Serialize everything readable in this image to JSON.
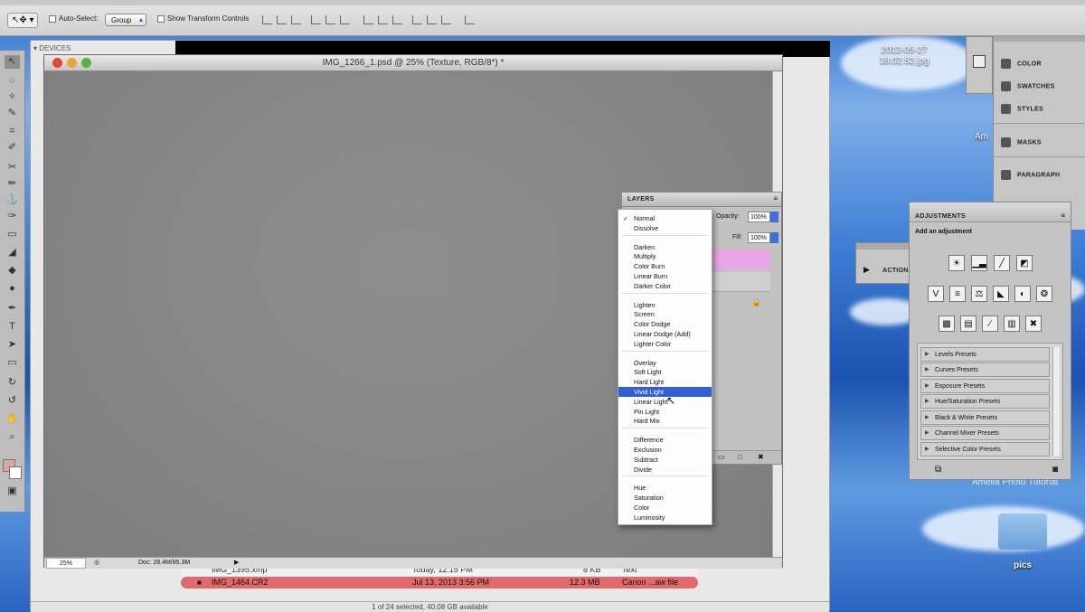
{
  "app": {
    "document_title": "IMG_1266_1.psd @ 25% (Texture, RGB/8*) *",
    "zoom": "25%",
    "doc_size": "Doc: 28.4M/85.3M"
  },
  "options_bar": {
    "auto_select_label": "Auto-Select:",
    "auto_select_value": "Group",
    "show_transform_label": "Show Transform Controls"
  },
  "finder": {
    "sidebar_header": "DEVICES",
    "rows": [
      {
        "name": "IMG_1395.xmp",
        "date": "Today, 12:15 PM",
        "size": "8 KB",
        "kind": "Text"
      },
      {
        "name": "IMG_1464.CR2",
        "date": "Jul 13, 2013 3:56 PM",
        "size": "12.3 MB",
        "kind": "Canon ...aw file"
      }
    ],
    "status": "1 of 24 selected, 40.08 GB available"
  },
  "desktop": {
    "file_label_line1": "2013-05-27",
    "file_label_line2": "18.02.52.jpg",
    "folder_label": "pics",
    "watermark": "Amelia Photo Tutorial",
    "partial_text": "Am"
  },
  "layers_panel": {
    "tab": "LAYERS",
    "opacity_label": "Opacity:",
    "opacity_value": "100%",
    "fill_label": "Fill:",
    "fill_value": "100%"
  },
  "blend_modes": {
    "checked": "Normal",
    "highlighted": "Vivid Light",
    "groups": [
      [
        "Normal",
        "Dissolve"
      ],
      [
        "Darken",
        "Multiply",
        "Color Burn",
        "Linear Burn",
        "Darker Color"
      ],
      [
        "Lighten",
        "Screen",
        "Color Dodge",
        "Linear Dodge (Add)",
        "Lighter Color"
      ],
      [
        "Overlay",
        "Soft Light",
        "Hard Light",
        "Vivid Light",
        "Linear Light",
        "Pin Light",
        "Hard Mix"
      ],
      [
        "Difference",
        "Exclusion",
        "Subtract",
        "Divide"
      ],
      [
        "Hue",
        "Saturation",
        "Color",
        "Luminosity"
      ]
    ]
  },
  "right_dock": {
    "items": [
      "COLOR",
      "SWATCHES",
      "STYLES",
      "MASKS",
      "PARAGRAPH"
    ]
  },
  "actions_panel": {
    "tab": "ACTIONS"
  },
  "adjustments_panel": {
    "tab": "ADJUSTMENTS",
    "subtitle": "Add an adjustment",
    "icons_row1": [
      "brightness-contrast-icon",
      "levels-icon",
      "curves-icon",
      "exposure-icon"
    ],
    "icons_row2": [
      "vibrance-icon",
      "hue-saturation-icon",
      "color-balance-icon",
      "black-white-icon",
      "photo-filter-icon",
      "channel-mixer-icon"
    ],
    "icons_row3": [
      "invert-icon",
      "posterize-icon",
      "threshold-icon",
      "gradient-map-icon",
      "selective-color-icon"
    ],
    "presets": [
      "Levels Presets",
      "Curves Presets",
      "Exposure Presets",
      "Hue/Saturation Presets",
      "Black & White Presets",
      "Channel Mixer Presets",
      "Selective Color Presets"
    ]
  },
  "colors": {
    "highlight": "#2f5ed6",
    "selected_row": "#e06a6a",
    "layer_swatch": "#e8a8e8"
  }
}
